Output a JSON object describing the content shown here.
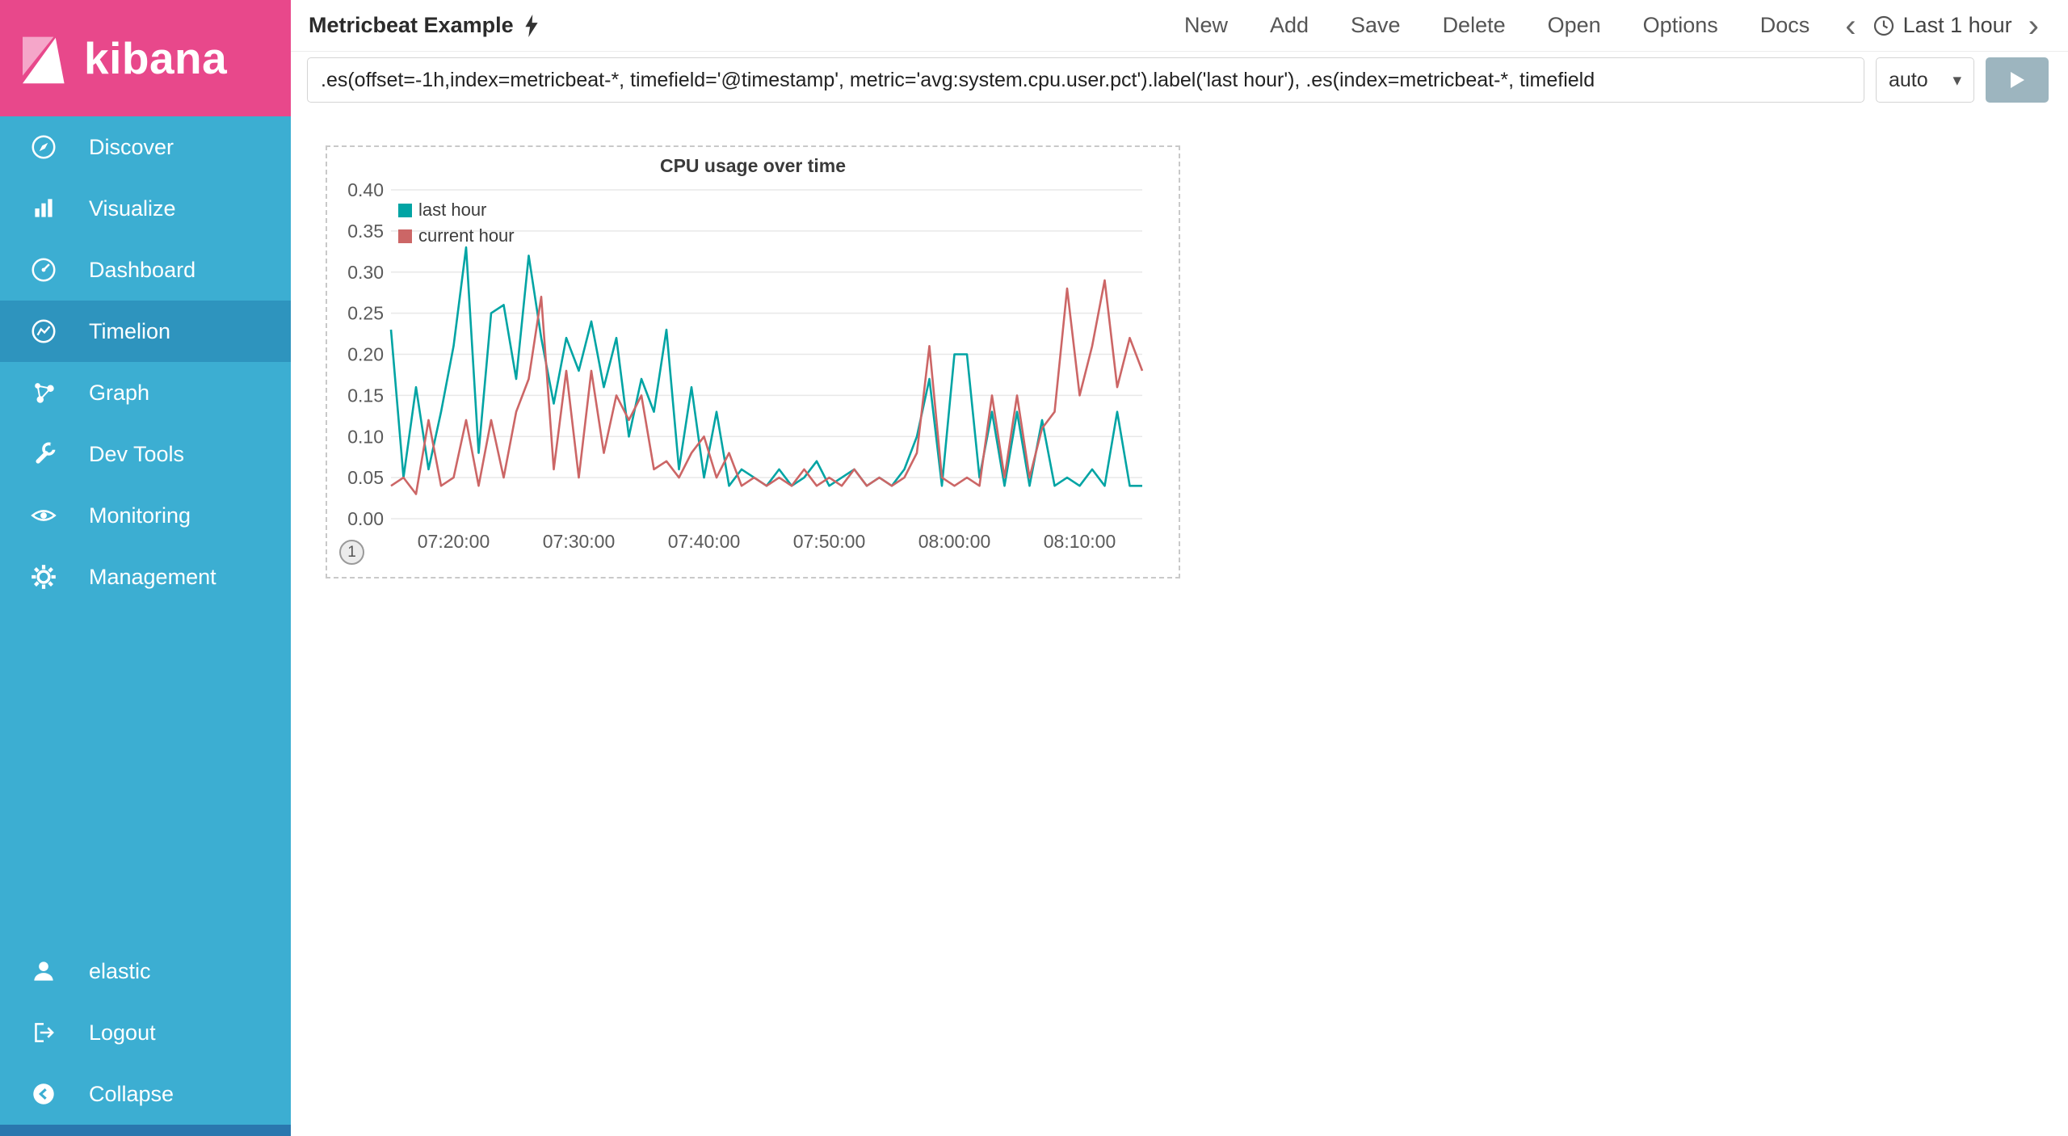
{
  "branding": {
    "logo_text": "kibana"
  },
  "sidebar": {
    "items": [
      {
        "label": "Discover"
      },
      {
        "label": "Visualize"
      },
      {
        "label": "Dashboard"
      },
      {
        "label": "Timelion",
        "active": true
      },
      {
        "label": "Graph"
      },
      {
        "label": "Dev Tools"
      },
      {
        "label": "Monitoring"
      },
      {
        "label": "Management"
      }
    ],
    "footer": [
      {
        "label": "elastic"
      },
      {
        "label": "Logout"
      },
      {
        "label": "Collapse"
      }
    ]
  },
  "topbar": {
    "title": "Metricbeat Example",
    "menu": [
      "New",
      "Add",
      "Save",
      "Delete",
      "Open",
      "Options",
      "Docs"
    ],
    "prev": "‹",
    "next": "›",
    "timepicker": "Last 1 hour"
  },
  "query": {
    "value": ".es(offset=-1h,index=metricbeat-*, timefield='@timestamp', metric='avg:system.cpu.user.pct').label('last hour'), .es(index=metricbeat-*, timefield",
    "interval": "auto",
    "caret": "▾"
  },
  "panel": {
    "badge": "1"
  },
  "colors": {
    "brand_pink": "#e8488b",
    "sidebar_blue": "#3caed2",
    "sidebar_active": "#2e94be",
    "series_teal": "#01a4a4",
    "series_red": "#cc6666"
  },
  "chart_data": {
    "type": "line",
    "title": "CPU usage over time",
    "xlabel": "",
    "ylabel": "",
    "ylim": [
      0,
      0.4
    ],
    "y_tick_labels": [
      "0.00",
      "0.05",
      "0.10",
      "0.15",
      "0.20",
      "0.25",
      "0.30",
      "0.35",
      "0.40"
    ],
    "x_range_minutes": [
      0,
      60
    ],
    "step_minutes": 1,
    "grid": "horizontal",
    "legend_position": "top-left",
    "x_ticks": [
      {
        "label": "07:20:00",
        "minute": 5
      },
      {
        "label": "07:30:00",
        "minute": 15
      },
      {
        "label": "07:40:00",
        "minute": 25
      },
      {
        "label": "07:50:00",
        "minute": 35
      },
      {
        "label": "08:00:00",
        "minute": 45
      },
      {
        "label": "08:10:00",
        "minute": 55
      }
    ],
    "series": [
      {
        "name": "last hour",
        "color": "#01a4a4",
        "values": [
          0.23,
          0.05,
          0.16,
          0.06,
          0.13,
          0.21,
          0.33,
          0.08,
          0.25,
          0.26,
          0.17,
          0.32,
          0.22,
          0.14,
          0.22,
          0.18,
          0.24,
          0.16,
          0.22,
          0.1,
          0.17,
          0.13,
          0.23,
          0.06,
          0.16,
          0.05,
          0.13,
          0.04,
          0.06,
          0.05,
          0.04,
          0.06,
          0.04,
          0.05,
          0.07,
          0.04,
          0.05,
          0.06,
          0.04,
          0.05,
          0.04,
          0.06,
          0.1,
          0.17,
          0.04,
          0.2,
          0.2,
          0.05,
          0.13,
          0.04,
          0.13,
          0.04,
          0.12,
          0.04,
          0.05,
          0.04,
          0.06,
          0.04,
          0.13,
          0.04,
          0.04
        ]
      },
      {
        "name": "current hour",
        "color": "#cc6666",
        "values": [
          0.04,
          0.05,
          0.03,
          0.12,
          0.04,
          0.05,
          0.12,
          0.04,
          0.12,
          0.05,
          0.13,
          0.17,
          0.27,
          0.06,
          0.18,
          0.05,
          0.18,
          0.08,
          0.15,
          0.12,
          0.15,
          0.06,
          0.07,
          0.05,
          0.08,
          0.1,
          0.05,
          0.08,
          0.04,
          0.05,
          0.04,
          0.05,
          0.04,
          0.06,
          0.04,
          0.05,
          0.04,
          0.06,
          0.04,
          0.05,
          0.04,
          0.05,
          0.08,
          0.21,
          0.05,
          0.04,
          0.05,
          0.04,
          0.15,
          0.05,
          0.15,
          0.05,
          0.11,
          0.13,
          0.28,
          0.15,
          0.21,
          0.29,
          0.16,
          0.22,
          0.18
        ]
      }
    ]
  }
}
